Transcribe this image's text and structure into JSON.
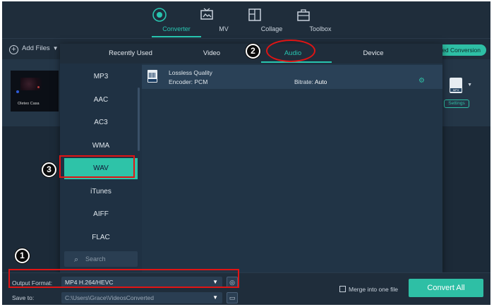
{
  "nav": {
    "items": [
      {
        "label": "Converter",
        "icon": "converter-icon",
        "active": true
      },
      {
        "label": "MV",
        "icon": "mv-icon",
        "active": false
      },
      {
        "label": "Collage",
        "icon": "collage-icon",
        "active": false
      },
      {
        "label": "Toolbox",
        "icon": "toolbox-icon",
        "active": false
      }
    ]
  },
  "toolbar": {
    "add_files": "Add Files",
    "conversion_pill": "ed Conversion"
  },
  "file": {
    "thumbnail_caption": "Oleteo Casa",
    "format_badge": "MP4",
    "settings_label": "Settings"
  },
  "popup": {
    "tabs": [
      "Recently Used",
      "Video",
      "Audio",
      "Device"
    ],
    "active_tab": "Audio",
    "formats": [
      "MP3",
      "AAC",
      "AC3",
      "WMA",
      "WAV",
      "iTunes",
      "AIFF",
      "FLAC"
    ],
    "selected_format": "WAV",
    "search_placeholder": "Search",
    "preset": {
      "name": "Lossless Quality",
      "encoder": "Encoder: PCM",
      "bitrate_label": "Bitrate:",
      "bitrate_value": "Auto"
    }
  },
  "bottom": {
    "output_format_label": "Output Format:",
    "output_format_value": "MP4 H.264/HEVC",
    "save_to_label": "Save to:",
    "save_to_value": "C:\\Users\\Grace\\VideosConverted",
    "merge_label": "Merge into one file",
    "convert_all": "Convert All"
  },
  "annotations": {
    "step1": "1",
    "step2": "2",
    "step3": "3",
    "highlight_color": "#e01414"
  },
  "colors": {
    "accent": "#28c5b0",
    "background": "#1c2a38"
  }
}
